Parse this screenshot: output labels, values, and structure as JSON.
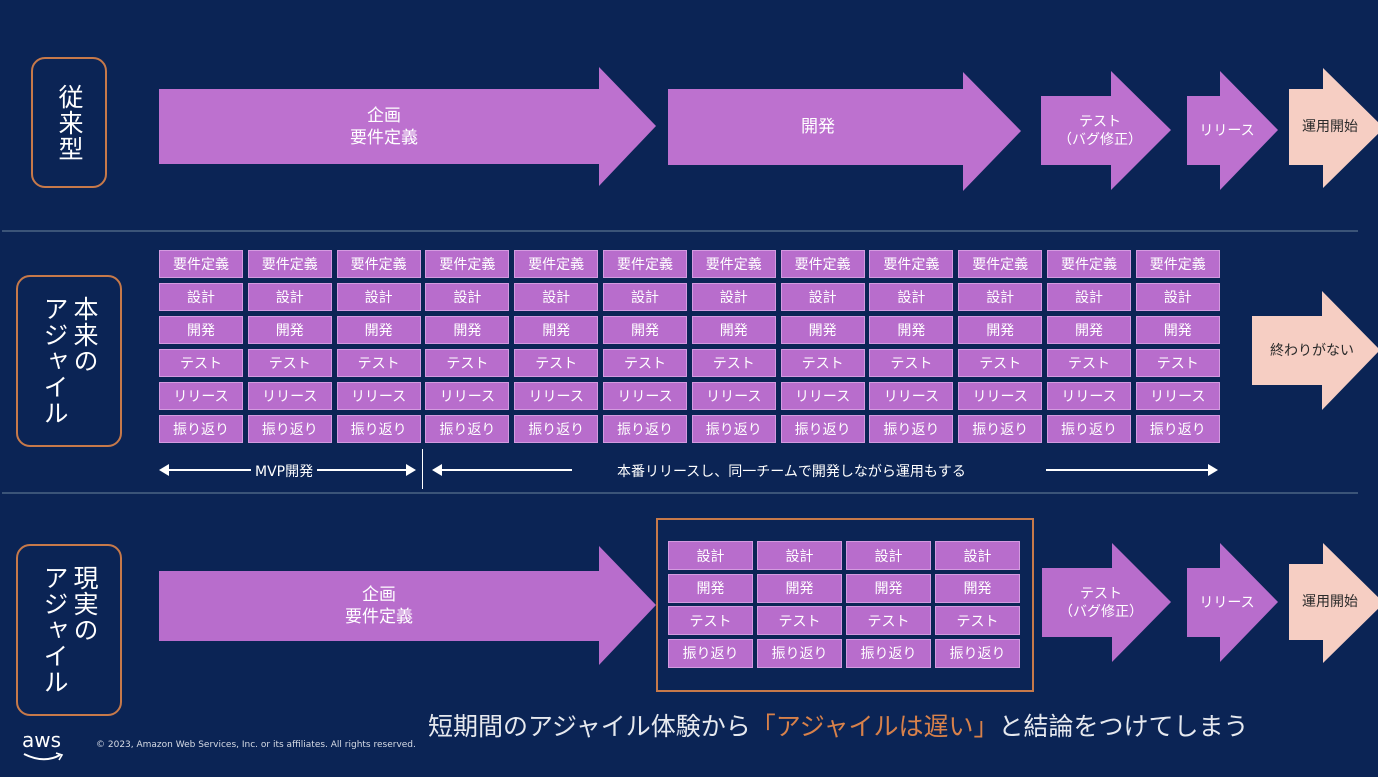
{
  "colors": {
    "background": "#0b2455",
    "arrow_purple": "#bd71cf",
    "arrow_pink": "#f6cec3",
    "label_border": "#c7794a",
    "highlight": "#d8814a"
  },
  "rows": {
    "traditional": {
      "label": "従来型",
      "arrows": [
        {
          "lines": [
            "企画",
            "要件定義"
          ],
          "style": "purple"
        },
        {
          "lines": [
            "開発"
          ],
          "style": "purple"
        },
        {
          "lines": [
            "テスト",
            "（バグ修正）"
          ],
          "style": "purple"
        },
        {
          "lines": [
            "リリース"
          ],
          "style": "purple"
        },
        {
          "lines": [
            "運用開始"
          ],
          "style": "pink"
        }
      ]
    },
    "true_agile": {
      "label": "本来のアジャイル",
      "label_lines": [
        "本来の",
        "アジャイル"
      ],
      "iteration_count": 12,
      "steps": [
        "要件定義",
        "設計",
        "開発",
        "テスト",
        "リリース",
        "振り返り"
      ],
      "end_arrow": "終わりがない",
      "timeline": {
        "mvp_label": "MVP開発",
        "ops_label": "本番リリースし、同一チームで開発しながら運用もする"
      }
    },
    "real_agile": {
      "label": "現実のアジャイル",
      "label_lines": [
        "現実の",
        "アジャイル"
      ],
      "first_arrow": [
        "企画",
        "要件定義"
      ],
      "iteration_count": 4,
      "steps": [
        "設計",
        "開発",
        "テスト",
        "振り返り"
      ],
      "arrows": [
        {
          "lines": [
            "テスト",
            "（バグ修正）"
          ],
          "style": "purple"
        },
        {
          "lines": [
            "リリース"
          ],
          "style": "purple"
        },
        {
          "lines": [
            "運用開始"
          ],
          "style": "pink"
        }
      ]
    }
  },
  "caption": {
    "before": "短期間のアジャイル体験から",
    "highlight": "「アジャイルは遅い」",
    "after": "と結論をつけてしまう"
  },
  "footer": {
    "logo": "aws",
    "copyright": "© 2023, Amazon Web Services, Inc. or its affiliates. All rights reserved."
  }
}
